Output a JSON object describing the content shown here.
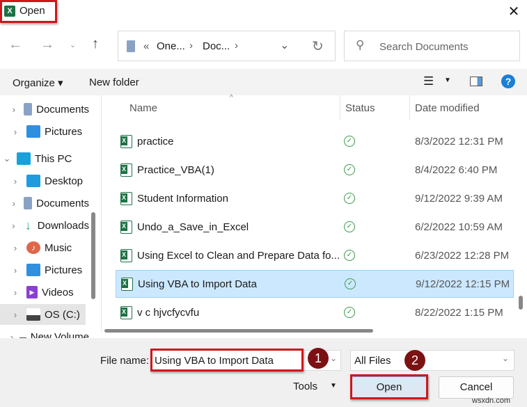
{
  "title": "Open",
  "address": {
    "prefix": "«",
    "crumbs": [
      "One...",
      "Doc..."
    ]
  },
  "search": {
    "placeholder": "Search Documents"
  },
  "toolbar": {
    "organize": "Organize ▾",
    "new_folder": "New folder",
    "help": "?"
  },
  "sidebar": {
    "items": [
      {
        "label": "Documents",
        "color": "#8aa3c4"
      },
      {
        "label": "Pictures",
        "color": "#2f8fe0"
      },
      {
        "label": "This PC",
        "color": "#1aa1d9"
      },
      {
        "label": "Desktop",
        "color": "#1f9be0"
      },
      {
        "label": "Documents",
        "color": "#8aa3c4"
      },
      {
        "label": "Downloads",
        "color": "#2aa77a"
      },
      {
        "label": "Music",
        "color": "#e0664a"
      },
      {
        "label": "Pictures",
        "color": "#2f8fe0"
      },
      {
        "label": "Videos",
        "color": "#8a3fd1"
      },
      {
        "label": "OS (C:)",
        "color": "#444"
      },
      {
        "label": "New Volume",
        "color": "#555"
      }
    ]
  },
  "columns": {
    "name": "Name",
    "status": "Status",
    "date": "Date modified"
  },
  "files": [
    {
      "name": "practice",
      "status": "✓",
      "date": "8/3/2022 12:31 PM"
    },
    {
      "name": "Practice_VBA(1)",
      "status": "✓",
      "date": "8/4/2022 6:40 PM"
    },
    {
      "name": "Student Information",
      "status": "✓",
      "date": "9/12/2022 9:39 AM"
    },
    {
      "name": "Undo_a_Save_in_Excel",
      "status": "✓",
      "date": "6/2/2022 10:59 AM"
    },
    {
      "name": "Using Excel to Clean and Prepare Data fo...",
      "status": "✓",
      "date": "6/23/2022 12:28 PM"
    },
    {
      "name": "Using VBA to Import Data",
      "status": "✓",
      "date": "9/12/2022 12:15 PM"
    },
    {
      "name": "v c hjvcfycvfu",
      "status": "✓",
      "date": "8/22/2022 1:15 PM"
    }
  ],
  "footer": {
    "file_name_label": "File name:",
    "file_name_value": "Using VBA to Import Data",
    "file_type": "All Files",
    "tools": "Tools",
    "open": "Open",
    "cancel": "Cancel",
    "step1": "1",
    "step2": "2",
    "watermark": "wsxdn.com"
  }
}
